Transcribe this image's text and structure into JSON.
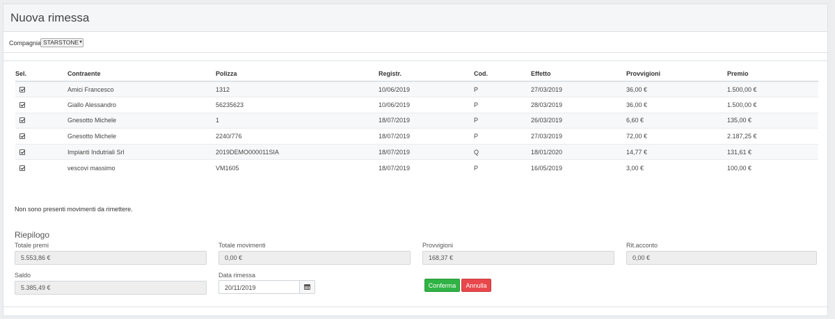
{
  "header": {
    "title": "Nuova rimessa"
  },
  "filter": {
    "company_label": "Compagnia",
    "company_value": "STARSTONE"
  },
  "table": {
    "columns": [
      "Sel.",
      "Contraente",
      "Polizza",
      "Registr.",
      "Cod.",
      "Effetto",
      "Provvigioni",
      "Premio"
    ],
    "rows": [
      {
        "selected": true,
        "contraente": "Amici Francesco",
        "polizza": "1312",
        "registr": "10/06/2019",
        "cod": "P",
        "effetto": "27/03/2019",
        "provvigioni": "36,00 €",
        "premio": "1.500,00 €"
      },
      {
        "selected": true,
        "contraente": "Giallo Alessandro",
        "polizza": "56235623",
        "registr": "10/06/2019",
        "cod": "P",
        "effetto": "28/03/2019",
        "provvigioni": "36,00 €",
        "premio": "1.500,00 €"
      },
      {
        "selected": true,
        "contraente": "Gnesotto Michele",
        "polizza": "1",
        "registr": "18/07/2019",
        "cod": "P",
        "effetto": "26/03/2019",
        "provvigioni": "6,60 €",
        "premio": "135,00 €"
      },
      {
        "selected": true,
        "contraente": "Gnesotto Michele",
        "polizza": "2240/776",
        "registr": "18/07/2019",
        "cod": "P",
        "effetto": "27/03/2019",
        "provvigioni": "72,00 €",
        "premio": "2.187,25 €"
      },
      {
        "selected": true,
        "contraente": "Impianti Indutriali Srl",
        "polizza": "2019DEMO000011SIA",
        "registr": "18/07/2019",
        "cod": "Q",
        "effetto": "18/01/2020",
        "provvigioni": "14,77 €",
        "premio": "131,61 €"
      },
      {
        "selected": true,
        "contraente": "vescovi massimo",
        "polizza": "VM1605",
        "registr": "18/07/2019",
        "cod": "P",
        "effetto": "16/05/2019",
        "provvigioni": "3,00 €",
        "premio": "100,00 €"
      }
    ]
  },
  "messages": {
    "no_movements": "Non sono presenti movimenti da rimettere."
  },
  "summary": {
    "title": "Riepilogo",
    "totale_premi_label": "Totale premi",
    "totale_premi_value": "5.553,86 €",
    "totale_movimenti_label": "Totale movimenti",
    "totale_movimenti_value": "0,00 €",
    "provvigioni_label": "Provvigioni",
    "provvigioni_value": "168,37 €",
    "rit_acconto_label": "Rit.acconto",
    "rit_acconto_value": "0,00 €",
    "saldo_label": "Saldo",
    "saldo_value": "5.385,49 €",
    "data_rimessa_label": "Data rimessa",
    "data_rimessa_value": "20/11/2019"
  },
  "buttons": {
    "confirm": "Conferma",
    "cancel": "Annulla"
  },
  "colors": {
    "confirm": "#2fb344",
    "cancel": "#e8474c"
  },
  "icons": {
    "date_picker": "calendar-icon",
    "select": "chevron-down-icon"
  }
}
